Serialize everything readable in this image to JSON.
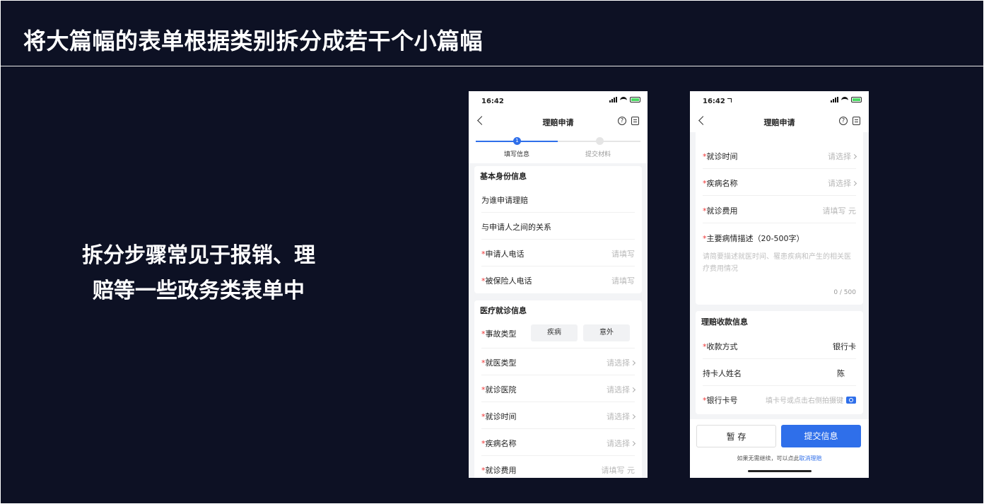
{
  "slide": {
    "title": "将大篇幅的表单根据类别拆分成若干个小篇幅",
    "caption_line1": "拆分步骤常见于报销、理",
    "caption_line2": "赔等一些政务类表单中"
  },
  "phone1": {
    "time": "16:42",
    "nav_title": "理赔申请",
    "help_glyph": "?",
    "steps": {
      "step1_number": "1",
      "step1_label": "填写信息",
      "step2_label": "提交材料"
    },
    "basic": {
      "title": "基本身份信息",
      "who_label": "为谁申请理赔",
      "relation_label": "与申请人之间的关系",
      "phone_label": "申请人电话",
      "phone_value": "请填写",
      "insured_phone_label": "被保险人电话",
      "insured_phone_value": "请填写"
    },
    "medical": {
      "title": "医疗就诊信息",
      "accident_label": "事故类型",
      "chip1": "疾病",
      "chip2": "意外",
      "visit_type_label": "就医类型",
      "visit_type_value": "请选择",
      "hospital_label": "就诊医院",
      "hospital_value": "请选择",
      "visit_time_label": "就诊时间",
      "visit_time_value": "请选择",
      "disease_label": "疾病名称",
      "disease_value": "请选择",
      "fee_label": "就诊费用",
      "fee_value": "请填写 元"
    }
  },
  "phone2": {
    "time": "16:42",
    "nav_title": "理赔申请",
    "help_glyph": "?",
    "medical": {
      "visit_time_label": "就诊时间",
      "visit_time_value": "请选择",
      "disease_label": "疾病名称",
      "disease_value": "请选择",
      "fee_label": "就诊费用",
      "fee_value": "请填写 元",
      "desc_label": "主要病情描述（20-500字）",
      "desc_placeholder": "请简要描述就医时间、罹患疾病和产生的相关医疗费用情况",
      "desc_count": "0 / 500"
    },
    "payment": {
      "title": "理赔收款信息",
      "method_label": "收款方式",
      "method_value": "银行卡",
      "holder_label": "持卡人姓名",
      "holder_value": "陈",
      "card_label": "银行卡号",
      "card_placeholder": "填卡号或点击右侧拍摄键"
    },
    "footer": {
      "save_label": "暂 存",
      "submit_label": "提交信息",
      "hint_text": "如果无需继续，可以点此",
      "hint_link": "取消理赔"
    }
  },
  "colors": {
    "background": "#0d1124",
    "accent": "#2f6fea",
    "required": "#e33333"
  }
}
